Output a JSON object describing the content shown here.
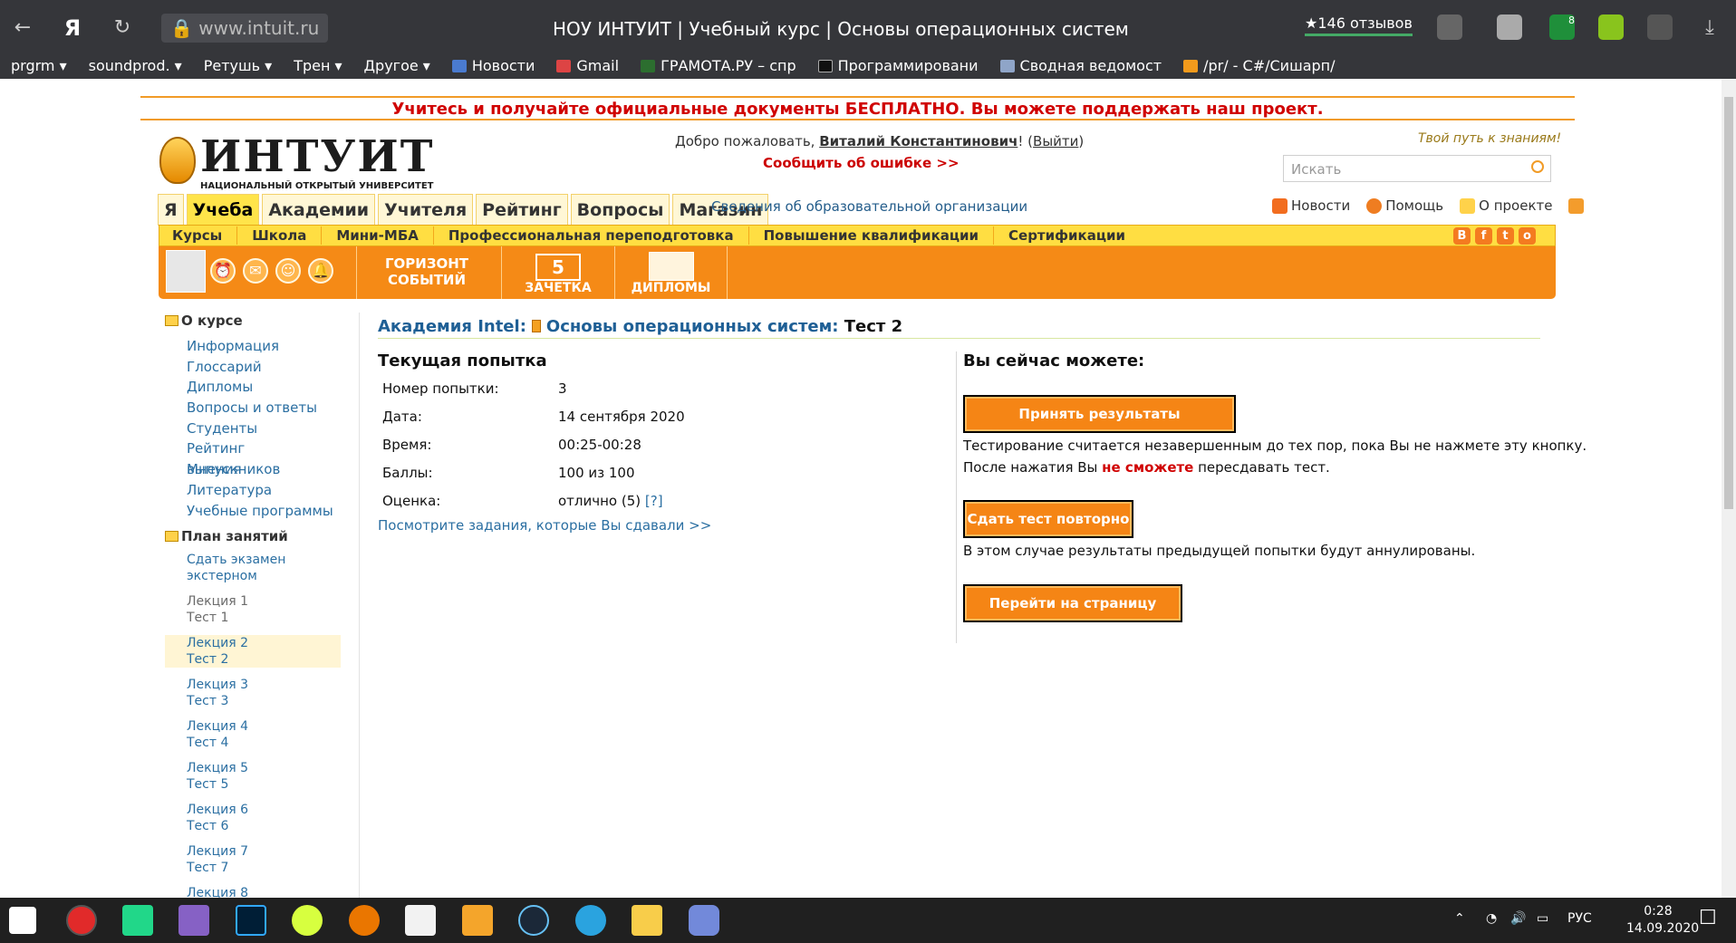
{
  "browser": {
    "url": "www.intuit.ru",
    "title": "НОУ ИНТУИТ | Учебный курс | Основы операционных систем",
    "reviews": "★146 отзывов",
    "badge": "8",
    "bookmarks": [
      "prgrm ▾",
      "soundprod. ▾",
      "Ретушь ▾",
      "Трен ▾",
      "Другое ▾",
      "Новости",
      "Gmail",
      "ГРАМОТА.РУ – спр",
      "Программировани",
      "Сводная ведомост",
      "/pr/ - C#/Сишарп/"
    ],
    "yandex_letter": "Я",
    "ext_colors": [
      "#7a7a7a",
      "#2e8b57",
      "#89c41d",
      "#8a8a8a"
    ]
  },
  "site": {
    "promo": "Учитесь и получайте официальные документы БЕСПЛАТНО. Вы можете поддержать наш проект.",
    "logo": "ИНТУИТ",
    "logo_sub": "НАЦИОНАЛЬНЫЙ ОТКРЫТЫЙ УНИВЕРСИТЕТ",
    "welcome_prefix": "Добро пожаловать, ",
    "user": "Виталий Константинович",
    "welcome_mid": "! (",
    "logout": "Выйти",
    "welcome_end": ")",
    "report": "Сообщить об ошибке >>",
    "motto": "Твой путь к знаниям!",
    "search_placeholder": "Искать",
    "tabs": [
      "Я",
      "Учеба",
      "Академии",
      "Учителя",
      "Рейтинг",
      "Вопросы",
      "Магазин"
    ],
    "org_link": "Сведения об образовательной организации",
    "top_links": [
      "Новости",
      "Помощь",
      "О проекте"
    ],
    "subnav": [
      "Курсы",
      "Школа",
      "Мини-МБА",
      "Профессиональная переподготовка",
      "Повышение квалификации",
      "Сертификации"
    ],
    "social": [
      "В",
      "f",
      "t",
      "о"
    ],
    "banners": [
      "ГОРИЗОНТ\nСОБЫТИЙ",
      "ЗАЧЕТКА",
      "ДИПЛОМЫ"
    ],
    "zachetka_num": "5"
  },
  "sidebar": {
    "about_title": "О курсе",
    "about_links": [
      "Информация",
      "Глоссарий",
      "Дипломы",
      "Вопросы и ответы",
      "Студенты",
      "Рейтинг выпускников",
      "Мнения",
      "Литература",
      "Учебные программы"
    ],
    "plan_title": "План занятий",
    "exam_1": "Сдать экзамен",
    "exam_2": "экстерном",
    "lessons": [
      {
        "lecture": "Лекция 1",
        "test": "Тест 1"
      },
      {
        "lecture": "Лекция 2",
        "test": "Тест 2"
      },
      {
        "lecture": "Лекция 3",
        "test": "Тест 3"
      },
      {
        "lecture": "Лекция 4",
        "test": "Тест 4"
      },
      {
        "lecture": "Лекция 5",
        "test": "Тест 5"
      },
      {
        "lecture": "Лекция 6",
        "test": "Тест 6"
      },
      {
        "lecture": "Лекция 7",
        "test": "Тест 7"
      },
      {
        "lecture": "Лекция 8",
        "test": ""
      }
    ]
  },
  "content": {
    "academy": "Академия Intel",
    "colon1": ":",
    "course": "Основы операционных систем",
    "colon2": ":",
    "current": " Тест 2",
    "attempt_title": "Текущая попытка",
    "rows": [
      {
        "label": "Номер попытки:",
        "value": "3"
      },
      {
        "label": "Дата:",
        "value": "14 сентября 2020"
      },
      {
        "label": "Время:",
        "value": "00:25-00:28"
      },
      {
        "label": "Баллы:",
        "value": "100 из 100"
      },
      {
        "label": "Оценка:",
        "value": "отлично (5) "
      }
    ],
    "help": "[?]",
    "tasks_link": "Посмотрите задания, которые Вы сдавали >>",
    "can_title": "Вы сейчас можете:",
    "accept_btn": "Принять результаты тестирования",
    "accept_note": "Тестирование считается незавершенным до тех пор, пока Вы не нажмете эту кнопку.",
    "after_1": "После нажатия Вы ",
    "after_red": "не сможете",
    "after_2": " пересдавать тест.",
    "retake_btn": "Сдать тест повторно",
    "retake_note": "В этом случае результаты предыдущей попытки будут аннулированы.",
    "course_btn": "Перейти на страницу курса"
  },
  "taskbar": {
    "lang": "РУС",
    "time": "0:28",
    "date": "14.09.2020"
  }
}
